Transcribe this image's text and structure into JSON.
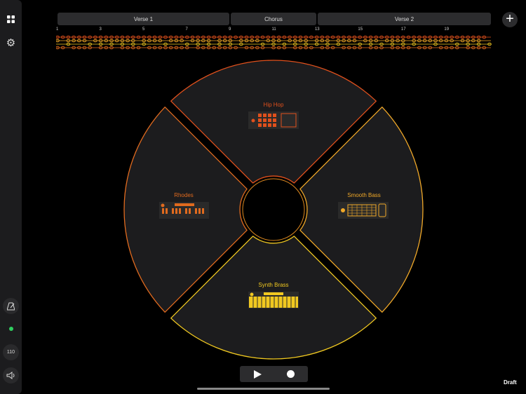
{
  "sidebar": {
    "tempo": "110",
    "status_color": "#30d060"
  },
  "sections": [
    {
      "label": "Verse 1"
    },
    {
      "label": "Chorus"
    },
    {
      "label": "Verse 2"
    }
  ],
  "bars": [
    "1",
    "3",
    "5",
    "7",
    "9",
    "11",
    "13",
    "15",
    "17",
    "19"
  ],
  "tracks": [
    {
      "name": "Hip Hop",
      "color": "#e0501c"
    },
    {
      "name": "Rhodes",
      "color": "#e06a1e"
    },
    {
      "name": "Smooth Bass",
      "color": "#f0a828"
    },
    {
      "name": "Synth Brass",
      "color": "#f0c820"
    }
  ],
  "status": "Draft"
}
